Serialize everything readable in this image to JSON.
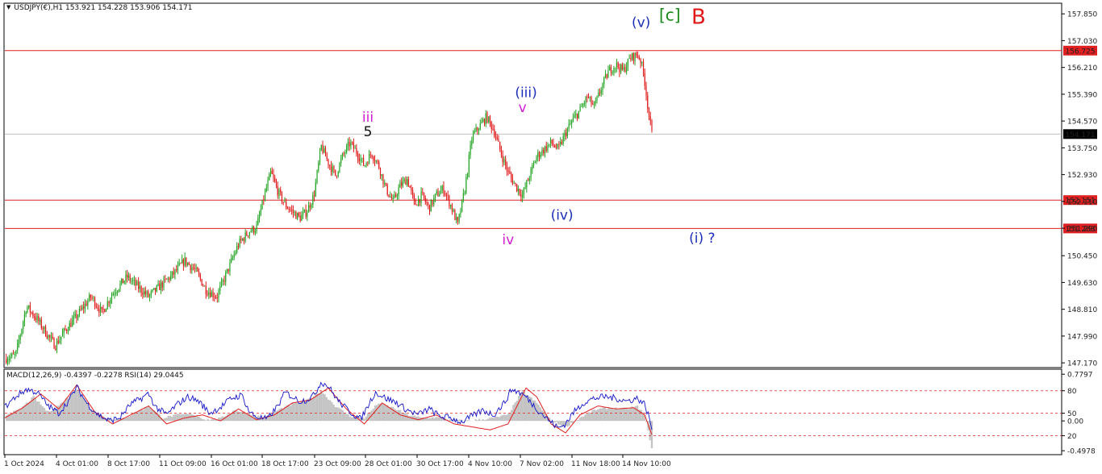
{
  "header": {
    "symbol_line": "USDJPY(€),H1  153.921 154.228 153.906 154.171",
    "indicator_line": "MACD(12,26,9) -0.4397 -0.2278  RSI(14) 29.0445"
  },
  "colors": {
    "bull": "#23a423",
    "bear": "#e01818",
    "hline": "#e02020",
    "rsi": "#1414c8",
    "macd_line": "#e02020",
    "macd_hist": "#c4c4c4",
    "last_price_bg": "#000000"
  },
  "chart_data": [
    {
      "type": "candlestick",
      "title": "USDJPY(€),H1",
      "ohlc_last": {
        "open": 153.921,
        "high": 154.228,
        "low": 153.906,
        "close": 154.171
      },
      "ylim": [
        147.05,
        158.15
      ],
      "y_ticks": [
        "157.850",
        "157.030",
        "156.210",
        "155.390",
        "154.570",
        "153.750",
        "152.930",
        "152.110",
        "151.290",
        "150.450",
        "149.630",
        "148.810",
        "147.990",
        "147.170"
      ],
      "x_ticks": [
        "1 Oct 2024",
        "4 Oct 01:00",
        "8 Oct 17:00",
        "11 Oct 09:00",
        "16 Oct 01:00",
        "18 Oct 17:00",
        "23 Oct 09:00",
        "28 Oct 01:00",
        "30 Oct 17:00",
        "4 Nov 10:00",
        "7 Nov 02:00",
        "11 Nov 18:00",
        "14 Nov 10:00"
      ],
      "price_path": [
        [
          0,
          147.3
        ],
        [
          3,
          147.4
        ],
        [
          6,
          148.9
        ],
        [
          9,
          148.5
        ],
        [
          12,
          148.0
        ],
        [
          14,
          147.7
        ],
        [
          17,
          148.2
        ],
        [
          20,
          148.6
        ],
        [
          24,
          149.2
        ],
        [
          27,
          148.7
        ],
        [
          30,
          149.3
        ],
        [
          34,
          149.8
        ],
        [
          37,
          149.5
        ],
        [
          40,
          149.2
        ],
        [
          44,
          149.6
        ],
        [
          47,
          149.9
        ],
        [
          50,
          150.3
        ],
        [
          53,
          150.0
        ],
        [
          56,
          149.4
        ],
        [
          59,
          149.2
        ],
        [
          62,
          150.0
        ],
        [
          65,
          150.8
        ],
        [
          68,
          151.2
        ],
        [
          70,
          151.3
        ],
        [
          72,
          152.2
        ],
        [
          74,
          153.0
        ],
        [
          76,
          152.4
        ],
        [
          78,
          152.0
        ],
        [
          80,
          151.8
        ],
        [
          82,
          151.6
        ],
        [
          84,
          151.8
        ],
        [
          86,
          152.3
        ],
        [
          88,
          153.8
        ],
        [
          90,
          153.3
        ],
        [
          92,
          152.9
        ],
        [
          94,
          153.5
        ],
        [
          96,
          153.9
        ],
        [
          98,
          153.6
        ],
        [
          100,
          153.2
        ],
        [
          102,
          153.6
        ],
        [
          104,
          153.2
        ],
        [
          106,
          152.5
        ],
        [
          108,
          152.1
        ],
        [
          110,
          152.6
        ],
        [
          112,
          152.8
        ],
        [
          114,
          152.0
        ],
        [
          116,
          152.3
        ],
        [
          118,
          151.9
        ],
        [
          120,
          152.3
        ],
        [
          122,
          152.5
        ],
        [
          124,
          152.0
        ],
        [
          126,
          151.4
        ],
        [
          128,
          152.5
        ],
        [
          130,
          154.1
        ],
        [
          132,
          154.4
        ],
        [
          134,
          154.7
        ],
        [
          136,
          154.3
        ],
        [
          138,
          153.6
        ],
        [
          140,
          153.0
        ],
        [
          142,
          152.6
        ],
        [
          144,
          152.3
        ],
        [
          146,
          152.9
        ],
        [
          148,
          153.5
        ],
        [
          150,
          153.7
        ],
        [
          152,
          153.9
        ],
        [
          154,
          153.7
        ],
        [
          156,
          154.2
        ],
        [
          158,
          154.6
        ],
        [
          160,
          154.9
        ],
        [
          162,
          155.3
        ],
        [
          164,
          155.0
        ],
        [
          166,
          155.6
        ],
        [
          168,
          156.1
        ],
        [
          170,
          156.3
        ],
        [
          172,
          156.1
        ],
        [
          174,
          156.5
        ],
        [
          176,
          156.6
        ],
        [
          177,
          156.4
        ],
        [
          178,
          155.8
        ],
        [
          179,
          154.9
        ],
        [
          180,
          154.17
        ]
      ],
      "horizontal_levels": [
        156.725,
        152.151,
        151.283
      ],
      "level_labels": [
        "156.725",
        "152.151",
        "151.283"
      ],
      "last_price": 154.171,
      "last_price_label": "154.171",
      "annotations": [
        {
          "text": "(v)",
          "x": 177,
          "y": 157.45,
          "color": "#1c2fb8"
        },
        {
          "text": "[c]",
          "x": 185,
          "y": 157.65,
          "color": "#1a8a1a"
        },
        {
          "text": "B",
          "x": 193,
          "y": 157.55,
          "color": "#e01818"
        },
        {
          "text": "iii",
          "x": 101,
          "y": 154.55,
          "color": "#d21ed2"
        },
        {
          "text": "5",
          "x": 101,
          "y": 154.1,
          "color": "#111111"
        },
        {
          "text": "(iii)",
          "x": 145,
          "y": 155.3,
          "color": "#1c2fb8"
        },
        {
          "text": "v",
          "x": 144,
          "y": 154.85,
          "color": "#d21ed2"
        },
        {
          "text": "(iv)",
          "x": 155,
          "y": 151.55,
          "color": "#1c2fb8"
        },
        {
          "text": "iv",
          "x": 140,
          "y": 150.8,
          "color": "#d21ed2"
        },
        {
          "text": "(i) ?",
          "x": 194,
          "y": 150.85,
          "color": "#1c2fb8"
        }
      ]
    },
    {
      "type": "line",
      "title": "MACD(12,26,9) RSI(14)",
      "ylim": [
        -0.55,
        0.85
      ],
      "y_ticks": [
        "0.7797",
        "80",
        "50",
        "0.00",
        "20",
        "-0.4978"
      ],
      "rsi_levels": [
        80,
        50,
        20
      ],
      "rsi_path": [
        [
          0,
          58
        ],
        [
          3,
          72
        ],
        [
          6,
          82
        ],
        [
          9,
          78
        ],
        [
          12,
          60
        ],
        [
          15,
          50
        ],
        [
          18,
          68
        ],
        [
          20,
          85
        ],
        [
          23,
          62
        ],
        [
          26,
          48
        ],
        [
          29,
          40
        ],
        [
          32,
          44
        ],
        [
          35,
          62
        ],
        [
          38,
          70
        ],
        [
          40,
          76
        ],
        [
          42,
          58
        ],
        [
          45,
          48
        ],
        [
          48,
          62
        ],
        [
          51,
          72
        ],
        [
          54,
          66
        ],
        [
          57,
          50
        ],
        [
          60,
          58
        ],
        [
          63,
          70
        ],
        [
          66,
          74
        ],
        [
          68,
          52
        ],
        [
          70,
          45
        ],
        [
          73,
          42
        ],
        [
          76,
          60
        ],
        [
          78,
          78
        ],
        [
          80,
          72
        ],
        [
          82,
          66
        ],
        [
          84,
          68
        ],
        [
          86,
          74
        ],
        [
          88,
          92
        ],
        [
          90,
          86
        ],
        [
          93,
          65
        ],
        [
          96,
          52
        ],
        [
          99,
          42
        ],
        [
          101,
          60
        ],
        [
          103,
          78
        ],
        [
          106,
          70
        ],
        [
          109,
          64
        ],
        [
          112,
          54
        ],
        [
          115,
          48
        ],
        [
          118,
          56
        ],
        [
          121,
          46
        ],
        [
          124,
          44
        ],
        [
          127,
          38
        ],
        [
          130,
          46
        ],
        [
          133,
          54
        ],
        [
          136,
          48
        ],
        [
          139,
          64
        ],
        [
          141,
          82
        ],
        [
          143,
          78
        ],
        [
          145,
          72
        ],
        [
          148,
          56
        ],
        [
          151,
          42
        ],
        [
          154,
          30
        ],
        [
          156,
          36
        ],
        [
          158,
          50
        ],
        [
          161,
          64
        ],
        [
          164,
          70
        ],
        [
          167,
          72
        ],
        [
          170,
          70
        ],
        [
          173,
          66
        ],
        [
          176,
          70
        ],
        [
          178,
          62
        ],
        [
          179,
          48
        ],
        [
          180,
          29
        ]
      ],
      "macd_signal_path": [
        [
          0,
          0.05
        ],
        [
          5,
          0.22
        ],
        [
          10,
          0.45
        ],
        [
          15,
          0.2
        ],
        [
          20,
          0.6
        ],
        [
          25,
          0.15
        ],
        [
          30,
          -0.05
        ],
        [
          35,
          0.1
        ],
        [
          40,
          0.25
        ],
        [
          45,
          -0.05
        ],
        [
          50,
          0.05
        ],
        [
          55,
          0.1
        ],
        [
          60,
          0.0
        ],
        [
          65,
          0.2
        ],
        [
          70,
          0.02
        ],
        [
          75,
          0.1
        ],
        [
          80,
          0.3
        ],
        [
          85,
          0.35
        ],
        [
          90,
          0.55
        ],
        [
          95,
          0.2
        ],
        [
          100,
          -0.05
        ],
        [
          105,
          0.3
        ],
        [
          110,
          0.1
        ],
        [
          115,
          0.02
        ],
        [
          120,
          0.1
        ],
        [
          125,
          -0.05
        ],
        [
          130,
          -0.1
        ],
        [
          135,
          -0.15
        ],
        [
          140,
          -0.05
        ],
        [
          145,
          0.55
        ],
        [
          148,
          0.4
        ],
        [
          152,
          -0.05
        ],
        [
          156,
          -0.2
        ],
        [
          160,
          0.1
        ],
        [
          165,
          0.25
        ],
        [
          170,
          0.2
        ],
        [
          175,
          0.22
        ],
        [
          178,
          0.1
        ],
        [
          180,
          -0.23
        ]
      ],
      "macd_hist_values": [
        [
          0,
          0.1
        ],
        [
          4,
          0.18
        ],
        [
          8,
          0.4
        ],
        [
          12,
          0.15
        ],
        [
          16,
          0.3
        ],
        [
          20,
          0.55
        ],
        [
          24,
          0.2
        ],
        [
          28,
          0.05
        ],
        [
          32,
          0.02
        ],
        [
          36,
          0.12
        ],
        [
          40,
          0.25
        ],
        [
          44,
          0.05
        ],
        [
          48,
          0.1
        ],
        [
          52,
          0.12
        ],
        [
          56,
          0.02
        ],
        [
          60,
          0.04
        ],
        [
          64,
          0.18
        ],
        [
          68,
          0.12
        ],
        [
          72,
          0.05
        ],
        [
          76,
          0.18
        ],
        [
          80,
          0.28
        ],
        [
          84,
          0.34
        ],
        [
          88,
          0.5
        ],
        [
          92,
          0.25
        ],
        [
          96,
          0.08
        ],
        [
          100,
          0.05
        ],
        [
          104,
          0.3
        ],
        [
          108,
          0.22
        ],
        [
          112,
          0.1
        ],
        [
          116,
          0.05
        ],
        [
          120,
          0.06
        ],
        [
          124,
          0.02
        ],
        [
          128,
          0.0
        ],
        [
          132,
          0.02
        ],
        [
          136,
          0.05
        ],
        [
          140,
          0.1
        ],
        [
          144,
          0.5
        ],
        [
          148,
          0.3
        ],
        [
          152,
          0.0
        ],
        [
          156,
          -0.1
        ],
        [
          160,
          0.05
        ],
        [
          164,
          0.18
        ],
        [
          168,
          0.22
        ],
        [
          172,
          0.2
        ],
        [
          176,
          0.24
        ],
        [
          178,
          0.1
        ],
        [
          180,
          -0.44
        ]
      ]
    }
  ]
}
